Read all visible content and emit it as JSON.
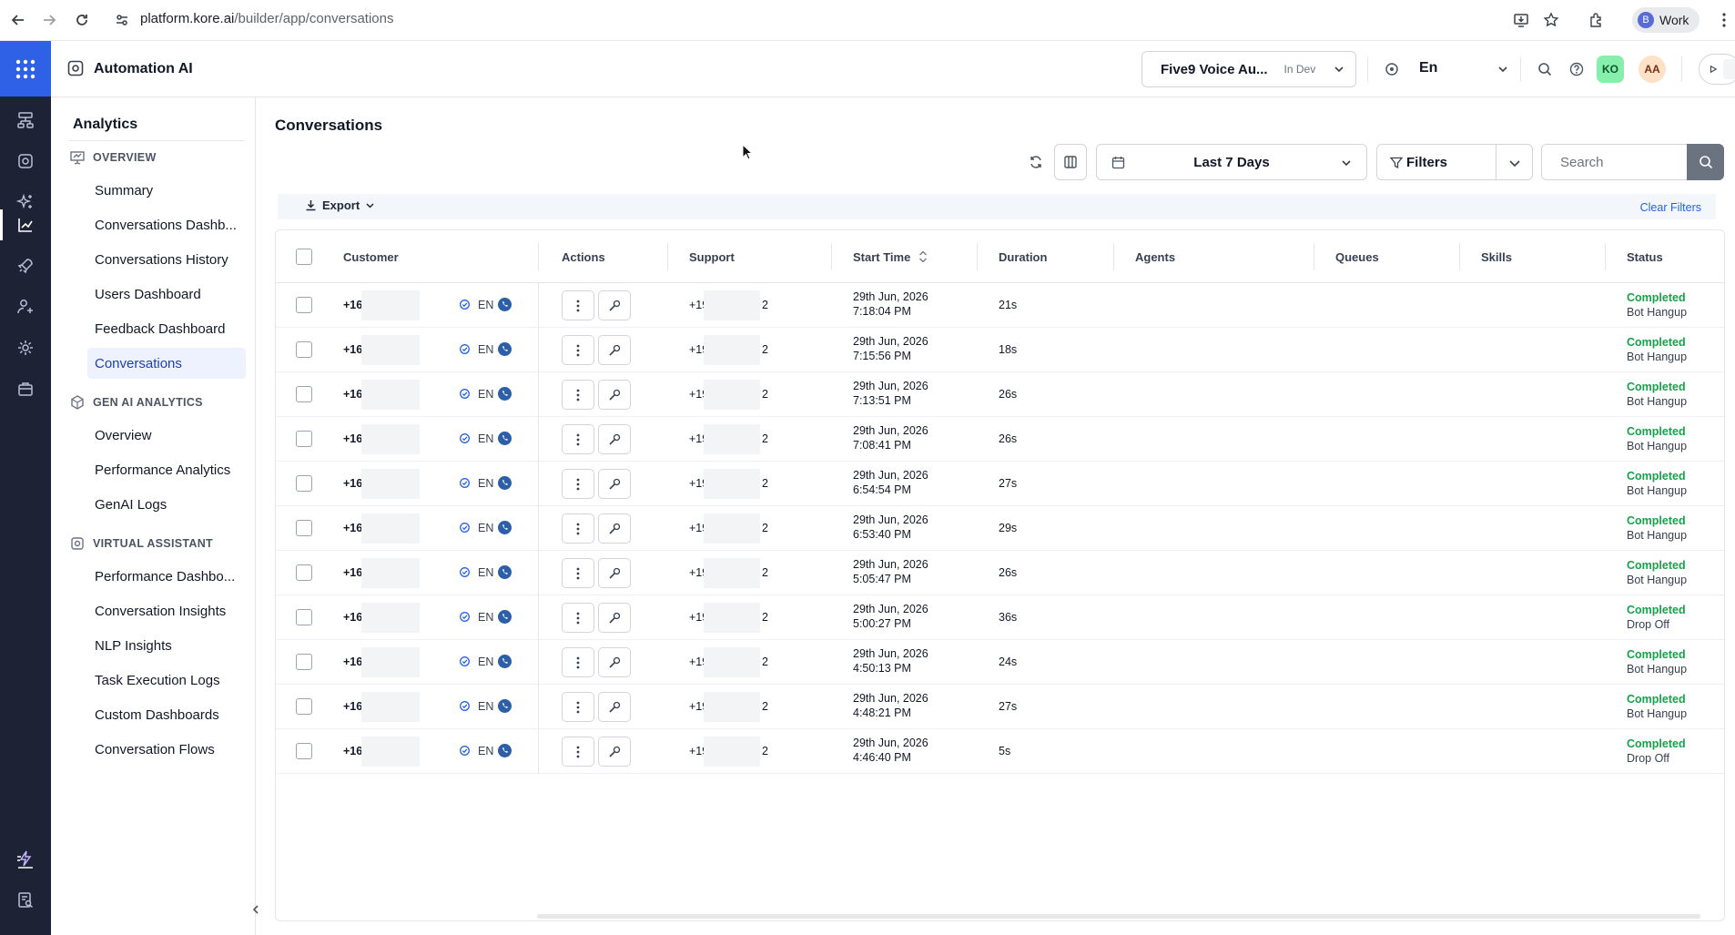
{
  "browser": {
    "url_host": "platform.kore.ai",
    "url_path": "/builder/app/conversations",
    "profile_initial": "B",
    "profile_label": "Work"
  },
  "app": {
    "title": "Automation AI",
    "bot_name": "Five9 Voice Au...",
    "bot_env": "In Dev",
    "language": "En",
    "user_badges": [
      "KO",
      "AA"
    ],
    "accent": "#2f61e7"
  },
  "sidebar": {
    "title": "Analytics",
    "sections": [
      {
        "label": "OVERVIEW",
        "icon": "presentation-icon",
        "items": [
          "Summary",
          "Conversations Dashb...",
          "Conversations History",
          "Users Dashboard",
          "Feedback Dashboard",
          "Conversations"
        ]
      },
      {
        "label": "GEN AI ANALYTICS",
        "icon": "genai-icon",
        "items": [
          "Overview",
          "Performance Analytics",
          "GenAI Logs"
        ]
      },
      {
        "label": "VIRTUAL ASSISTANT",
        "icon": "bot-icon",
        "items": [
          "Performance Dashbo...",
          "Conversation Insights",
          "NLP Insights",
          "Task Execution Logs",
          "Custom Dashboards",
          "Conversation Flows"
        ]
      }
    ],
    "active_item": "Conversations"
  },
  "main": {
    "title": "Conversations",
    "date_range": "Last 7 Days",
    "filters_label": "Filters",
    "search_placeholder": "Search",
    "export_label": "Export",
    "clear_filters_label": "Clear Filters"
  },
  "table": {
    "columns": [
      "Customer",
      "Actions",
      "Support",
      "Start Time",
      "Duration",
      "Agents",
      "Queues",
      "Skills",
      "Status"
    ],
    "rows": [
      {
        "customer": "+16",
        "lang": "EN",
        "support": "+19",
        "support_end": "2",
        "date": "29th Jun, 2026",
        "time": "7:18:04 PM",
        "duration": "21s",
        "status": "Completed",
        "reason": "Bot Hangup"
      },
      {
        "customer": "+16",
        "lang": "EN",
        "support": "+19",
        "support_end": "2",
        "date": "29th Jun, 2026",
        "time": "7:15:56 PM",
        "duration": "18s",
        "status": "Completed",
        "reason": "Bot Hangup"
      },
      {
        "customer": "+16",
        "lang": "EN",
        "support": "+19",
        "support_end": "2",
        "date": "29th Jun, 2026",
        "time": "7:13:51 PM",
        "duration": "26s",
        "status": "Completed",
        "reason": "Bot Hangup"
      },
      {
        "customer": "+16",
        "lang": "EN",
        "support": "+19",
        "support_end": "2",
        "date": "29th Jun, 2026",
        "time": "7:08:41 PM",
        "duration": "26s",
        "status": "Completed",
        "reason": "Bot Hangup"
      },
      {
        "customer": "+16",
        "lang": "EN",
        "support": "+19",
        "support_end": "2",
        "date": "29th Jun, 2026",
        "time": "6:54:54 PM",
        "duration": "27s",
        "status": "Completed",
        "reason": "Bot Hangup"
      },
      {
        "customer": "+16",
        "lang": "EN",
        "support": "+19",
        "support_end": "2",
        "date": "29th Jun, 2026",
        "time": "6:53:40 PM",
        "duration": "29s",
        "status": "Completed",
        "reason": "Bot Hangup"
      },
      {
        "customer": "+16",
        "lang": "EN",
        "support": "+19",
        "support_end": "2",
        "date": "29th Jun, 2026",
        "time": "5:05:47 PM",
        "duration": "26s",
        "status": "Completed",
        "reason": "Bot Hangup"
      },
      {
        "customer": "+16",
        "lang": "EN",
        "support": "+19",
        "support_end": "2",
        "date": "29th Jun, 2026",
        "time": "5:00:27 PM",
        "duration": "36s",
        "status": "Completed",
        "reason": "Drop Off"
      },
      {
        "customer": "+16",
        "lang": "EN",
        "support": "+19",
        "support_end": "2",
        "date": "29th Jun, 2026",
        "time": "4:50:13 PM",
        "duration": "24s",
        "status": "Completed",
        "reason": "Bot Hangup"
      },
      {
        "customer": "+16",
        "lang": "EN",
        "support": "+19",
        "support_end": "2",
        "date": "29th Jun, 2026",
        "time": "4:48:21 PM",
        "duration": "27s",
        "status": "Completed",
        "reason": "Bot Hangup"
      },
      {
        "customer": "+16",
        "lang": "EN",
        "support": "+19",
        "support_end": "2",
        "date": "29th Jun, 2026",
        "time": "4:46:40 PM",
        "duration": "5s",
        "status": "Completed",
        "reason": "Drop Off"
      }
    ]
  },
  "colors": {
    "status_completed": "#16a34a",
    "link": "#2563eb",
    "rail_bg": "#1e2235"
  }
}
